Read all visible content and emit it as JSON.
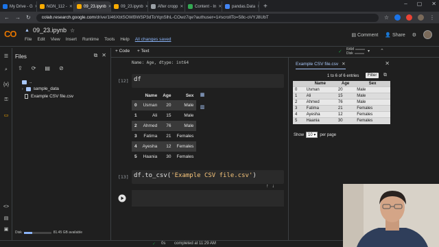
{
  "browser": {
    "tabs": [
      {
        "label": "My Drive - G",
        "color": "#1a73e8"
      },
      {
        "label": "NGN_112 -",
        "color": "#f9ab00"
      },
      {
        "label": "09_23.ipynb",
        "color": "#f9ab00"
      },
      {
        "label": "09_23.ipynb",
        "color": "#f9ab00"
      },
      {
        "label": "After cropp",
        "color": "#9aa0a6"
      },
      {
        "label": "Content - In",
        "color": "#34a853"
      },
      {
        "label": "pandas.Data",
        "color": "#4285f4"
      }
    ],
    "url_host": "colab.research.google.com",
    "url_path": "/drive/1l46XbtSOWBWSP3dToYqnSlhL-COwz7qe?authuser=1#scrollTo=58c-oVYJ8UbT"
  },
  "colab": {
    "logo": "CO",
    "notebook_title": "09_23.ipynb",
    "menu": [
      "File",
      "Edit",
      "View",
      "Insert",
      "Runtime",
      "Tools",
      "Help"
    ],
    "saved_status": "All changes saved",
    "comment_label": "Comment",
    "share_label": "Share",
    "add_code": "+ Code",
    "add_text": "+ Text",
    "ram_label": "RAM",
    "disk_label": "Disk"
  },
  "files": {
    "title": "Files",
    "items": [
      {
        "label": ".."
      },
      {
        "label": "sample_data"
      },
      {
        "label": "Example CSV file.csv"
      }
    ],
    "disk_label": "Disk",
    "disk_available": "81.45 GB available"
  },
  "notebook": {
    "prev_output": "Name: Age, dtype: int64",
    "cell1_no": "[12]",
    "cell1_code": "df",
    "df_headers": [
      "",
      "Name",
      "Age",
      "Sex"
    ],
    "df_rows": [
      [
        "0",
        "Usman",
        "20",
        "Male"
      ],
      [
        "1",
        "Ali",
        "15",
        "Male"
      ],
      [
        "2",
        "Ahmed",
        "76",
        "Male"
      ],
      [
        "3",
        "Fatima",
        "21",
        "Females"
      ],
      [
        "4",
        "Ayesha",
        "12",
        "Females"
      ],
      [
        "5",
        "Haania",
        "30",
        "Females"
      ]
    ],
    "cell2_no": "[13]",
    "cell2_code_pre": "df.to_csv(",
    "cell2_code_str": "'Example CSV file.csv'",
    "cell2_code_post": ")"
  },
  "csv_view": {
    "tab_label": "Example CSV file.csv",
    "entries_text": "1 to 6 of 6 entries",
    "filter_label": "Filter",
    "headers": [
      "",
      "Name",
      "Age",
      "Sex"
    ],
    "show_label": "Show",
    "show_value": "10",
    "per_page": "per page"
  },
  "status": {
    "check": "✓",
    "elapsed": "0s",
    "completed": "completed at 11:29 AM"
  }
}
